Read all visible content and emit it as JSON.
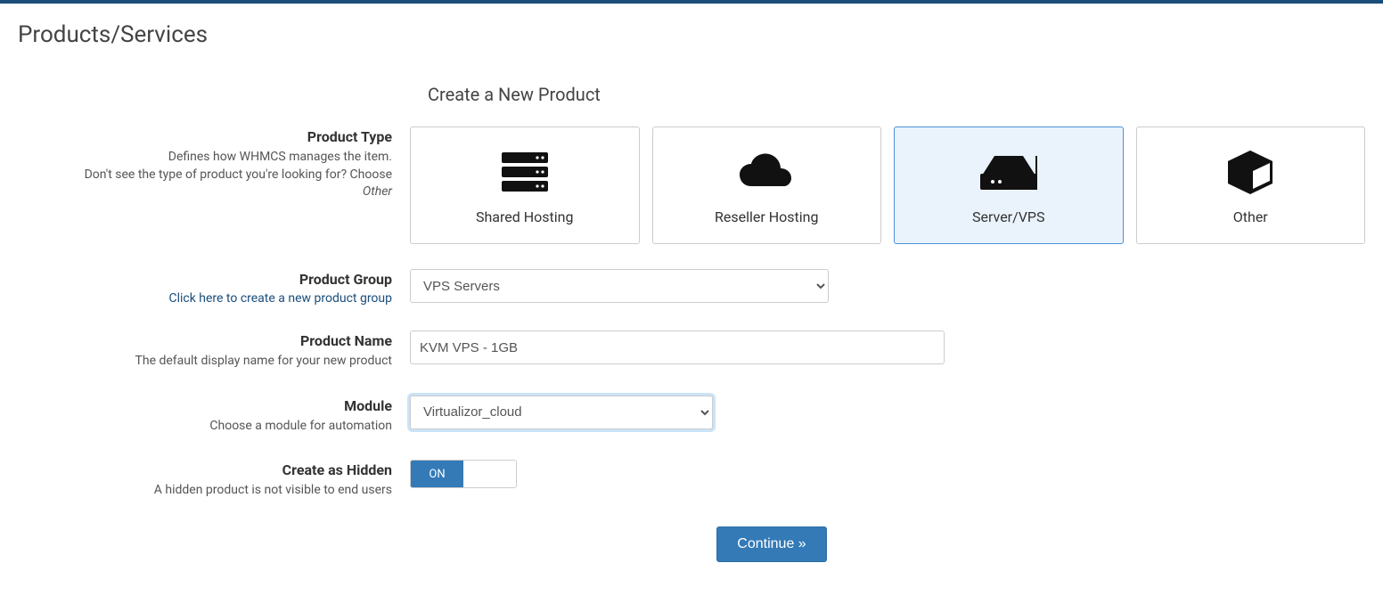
{
  "page_title": "Products/Services",
  "section_title": "Create a New Product",
  "labels": {
    "product_type": {
      "main": "Product Type",
      "help_line1": "Defines how WHMCS manages the item.",
      "help_line2_prefix": "Don't see the type of product you're looking for? Choose ",
      "help_line2_em": "Other"
    },
    "product_group": {
      "main": "Product Group",
      "link": "Click here to create a new product group"
    },
    "product_name": {
      "main": "Product Name",
      "help": "The default display name for your new product"
    },
    "module": {
      "main": "Module",
      "help": "Choose a module for automation"
    },
    "hidden": {
      "main": "Create as Hidden",
      "help": "A hidden product is not visible to end users"
    }
  },
  "product_types": [
    {
      "key": "shared",
      "label": "Shared Hosting",
      "selected": false
    },
    {
      "key": "reseller",
      "label": "Reseller Hosting",
      "selected": false
    },
    {
      "key": "server",
      "label": "Server/VPS",
      "selected": true
    },
    {
      "key": "other",
      "label": "Other",
      "selected": false
    }
  ],
  "product_group": {
    "selected": "VPS Servers"
  },
  "product_name": {
    "value": "KVM VPS - 1GB"
  },
  "module": {
    "selected": "Virtualizor_cloud"
  },
  "hidden_toggle": {
    "state": "ON"
  },
  "buttons": {
    "continue": "Continue »"
  }
}
